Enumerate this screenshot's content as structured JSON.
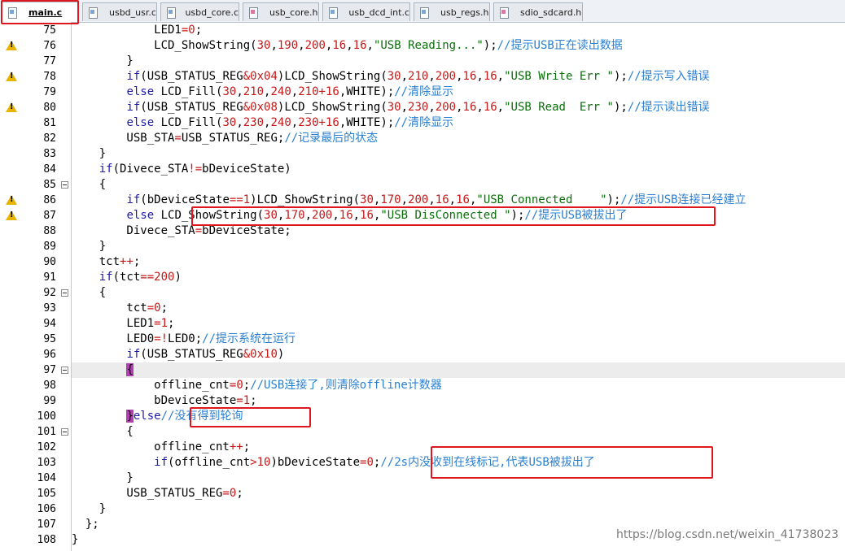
{
  "tabs": [
    {
      "label": "main.c",
      "type": "c",
      "active": true
    },
    {
      "label": "usbd_usr.c",
      "type": "c",
      "active": false
    },
    {
      "label": "usbd_core.c",
      "type": "c",
      "active": false
    },
    {
      "label": "usb_core.h",
      "type": "h",
      "active": false
    },
    {
      "label": "usb_dcd_int.c",
      "type": "c",
      "active": false
    },
    {
      "label": "usb_regs.h",
      "type": "c",
      "active": false
    },
    {
      "label": "sdio_sdcard.h",
      "type": "h",
      "active": false
    }
  ],
  "line_numbers": [
    "75",
    "76",
    "77",
    "78",
    "79",
    "80",
    "81",
    "82",
    "83",
    "84",
    "85",
    "86",
    "87",
    "88",
    "89",
    "90",
    "91",
    "92",
    "93",
    "94",
    "95",
    "96",
    "97",
    "98",
    "99",
    "100",
    "101",
    "102",
    "103",
    "104",
    "105",
    "106",
    "107",
    "108"
  ],
  "code": [
    [
      {
        "t": "            LED1",
        "c": ""
      },
      {
        "t": "=",
        "c": "op"
      },
      {
        "t": "0",
        "c": "num"
      },
      {
        "t": ";",
        "c": ""
      }
    ],
    [
      {
        "t": "            LCD_ShowString(",
        "c": ""
      },
      {
        "t": "30",
        "c": "num"
      },
      {
        "t": ",",
        "c": ""
      },
      {
        "t": "190",
        "c": "num"
      },
      {
        "t": ",",
        "c": ""
      },
      {
        "t": "200",
        "c": "num"
      },
      {
        "t": ",",
        "c": ""
      },
      {
        "t": "16",
        "c": "num"
      },
      {
        "t": ",",
        "c": ""
      },
      {
        "t": "16",
        "c": "num"
      },
      {
        "t": ",",
        "c": ""
      },
      {
        "t": "\"USB Reading...\"",
        "c": "str"
      },
      {
        "t": ");",
        "c": ""
      },
      {
        "t": "//提示USB正在读出数据",
        "c": "cm"
      }
    ],
    [
      {
        "t": "        }",
        "c": ""
      }
    ],
    [
      {
        "t": "        ",
        "c": ""
      },
      {
        "t": "if",
        "c": "kw"
      },
      {
        "t": "(USB_STATUS_REG",
        "c": ""
      },
      {
        "t": "&",
        "c": "op"
      },
      {
        "t": "0x04",
        "c": "num"
      },
      {
        "t": ")LCD_ShowString(",
        "c": ""
      },
      {
        "t": "30",
        "c": "num"
      },
      {
        "t": ",",
        "c": ""
      },
      {
        "t": "210",
        "c": "num"
      },
      {
        "t": ",",
        "c": ""
      },
      {
        "t": "200",
        "c": "num"
      },
      {
        "t": ",",
        "c": ""
      },
      {
        "t": "16",
        "c": "num"
      },
      {
        "t": ",",
        "c": ""
      },
      {
        "t": "16",
        "c": "num"
      },
      {
        "t": ",",
        "c": ""
      },
      {
        "t": "\"USB Write Err \"",
        "c": "str"
      },
      {
        "t": ");",
        "c": ""
      },
      {
        "t": "//提示写入错误",
        "c": "cm"
      }
    ],
    [
      {
        "t": "        ",
        "c": ""
      },
      {
        "t": "else",
        "c": "kw"
      },
      {
        "t": " LCD_Fill(",
        "c": ""
      },
      {
        "t": "30",
        "c": "num"
      },
      {
        "t": ",",
        "c": ""
      },
      {
        "t": "210",
        "c": "num"
      },
      {
        "t": ",",
        "c": ""
      },
      {
        "t": "240",
        "c": "num"
      },
      {
        "t": ",",
        "c": ""
      },
      {
        "t": "210",
        "c": "num"
      },
      {
        "t": "+",
        "c": "op"
      },
      {
        "t": "16",
        "c": "num"
      },
      {
        "t": ",WHITE);",
        "c": ""
      },
      {
        "t": "//清除显示",
        "c": "cm"
      }
    ],
    [
      {
        "t": "        ",
        "c": ""
      },
      {
        "t": "if",
        "c": "kw"
      },
      {
        "t": "(USB_STATUS_REG",
        "c": ""
      },
      {
        "t": "&",
        "c": "op"
      },
      {
        "t": "0x08",
        "c": "num"
      },
      {
        "t": ")LCD_ShowString(",
        "c": ""
      },
      {
        "t": "30",
        "c": "num"
      },
      {
        "t": ",",
        "c": ""
      },
      {
        "t": "230",
        "c": "num"
      },
      {
        "t": ",",
        "c": ""
      },
      {
        "t": "200",
        "c": "num"
      },
      {
        "t": ",",
        "c": ""
      },
      {
        "t": "16",
        "c": "num"
      },
      {
        "t": ",",
        "c": ""
      },
      {
        "t": "16",
        "c": "num"
      },
      {
        "t": ",",
        "c": ""
      },
      {
        "t": "\"USB Read  Err \"",
        "c": "str"
      },
      {
        "t": ");",
        "c": ""
      },
      {
        "t": "//提示读出错误",
        "c": "cm"
      }
    ],
    [
      {
        "t": "        ",
        "c": ""
      },
      {
        "t": "else",
        "c": "kw"
      },
      {
        "t": " LCD_Fill(",
        "c": ""
      },
      {
        "t": "30",
        "c": "num"
      },
      {
        "t": ",",
        "c": ""
      },
      {
        "t": "230",
        "c": "num"
      },
      {
        "t": ",",
        "c": ""
      },
      {
        "t": "240",
        "c": "num"
      },
      {
        "t": ",",
        "c": ""
      },
      {
        "t": "230",
        "c": "num"
      },
      {
        "t": "+",
        "c": "op"
      },
      {
        "t": "16",
        "c": "num"
      },
      {
        "t": ",WHITE);",
        "c": ""
      },
      {
        "t": "//清除显示",
        "c": "cm"
      }
    ],
    [
      {
        "t": "        USB_STA",
        "c": ""
      },
      {
        "t": "=",
        "c": "op"
      },
      {
        "t": "USB_STATUS_REG;",
        "c": ""
      },
      {
        "t": "//记录最后的状态",
        "c": "cm"
      }
    ],
    [
      {
        "t": "    }",
        "c": ""
      }
    ],
    [
      {
        "t": "    ",
        "c": ""
      },
      {
        "t": "if",
        "c": "kw"
      },
      {
        "t": "(Divece_STA",
        "c": ""
      },
      {
        "t": "!=",
        "c": "op"
      },
      {
        "t": "bDeviceState)",
        "c": ""
      }
    ],
    [
      {
        "t": "    {",
        "c": ""
      }
    ],
    [
      {
        "t": "        ",
        "c": ""
      },
      {
        "t": "if",
        "c": "kw"
      },
      {
        "t": "(bDeviceState",
        "c": ""
      },
      {
        "t": "==",
        "c": "op"
      },
      {
        "t": "1",
        "c": "num"
      },
      {
        "t": ")LCD_ShowString(",
        "c": ""
      },
      {
        "t": "30",
        "c": "num"
      },
      {
        "t": ",",
        "c": ""
      },
      {
        "t": "170",
        "c": "num"
      },
      {
        "t": ",",
        "c": ""
      },
      {
        "t": "200",
        "c": "num"
      },
      {
        "t": ",",
        "c": ""
      },
      {
        "t": "16",
        "c": "num"
      },
      {
        "t": ",",
        "c": ""
      },
      {
        "t": "16",
        "c": "num"
      },
      {
        "t": ",",
        "c": ""
      },
      {
        "t": "\"USB Connected    \"",
        "c": "str"
      },
      {
        "t": ");",
        "c": ""
      },
      {
        "t": "//提示USB连接已经建立",
        "c": "cm"
      }
    ],
    [
      {
        "t": "        ",
        "c": ""
      },
      {
        "t": "else",
        "c": "kw"
      },
      {
        "t": " LCD_ShowString(",
        "c": ""
      },
      {
        "t": "30",
        "c": "num"
      },
      {
        "t": ",",
        "c": ""
      },
      {
        "t": "170",
        "c": "num"
      },
      {
        "t": ",",
        "c": ""
      },
      {
        "t": "200",
        "c": "num"
      },
      {
        "t": ",",
        "c": ""
      },
      {
        "t": "16",
        "c": "num"
      },
      {
        "t": ",",
        "c": ""
      },
      {
        "t": "16",
        "c": "num"
      },
      {
        "t": ",",
        "c": ""
      },
      {
        "t": "\"USB DisConnected \"",
        "c": "str"
      },
      {
        "t": ");",
        "c": ""
      },
      {
        "t": "//提示USB被拔出了",
        "c": "cm"
      }
    ],
    [
      {
        "t": "        Divece_STA",
        "c": ""
      },
      {
        "t": "=",
        "c": "op"
      },
      {
        "t": "bDeviceState;",
        "c": ""
      }
    ],
    [
      {
        "t": "    }",
        "c": ""
      }
    ],
    [
      {
        "t": "    tct",
        "c": ""
      },
      {
        "t": "++",
        "c": "op"
      },
      {
        "t": ";",
        "c": ""
      }
    ],
    [
      {
        "t": "    ",
        "c": ""
      },
      {
        "t": "if",
        "c": "kw"
      },
      {
        "t": "(tct",
        "c": ""
      },
      {
        "t": "==",
        "c": "op"
      },
      {
        "t": "200",
        "c": "num"
      },
      {
        "t": ")",
        "c": ""
      }
    ],
    [
      {
        "t": "    {",
        "c": ""
      }
    ],
    [
      {
        "t": "        tct",
        "c": ""
      },
      {
        "t": "=",
        "c": "op"
      },
      {
        "t": "0",
        "c": "num"
      },
      {
        "t": ";",
        "c": ""
      }
    ],
    [
      {
        "t": "        LED1",
        "c": ""
      },
      {
        "t": "=",
        "c": "op"
      },
      {
        "t": "1",
        "c": "num"
      },
      {
        "t": ";",
        "c": ""
      }
    ],
    [
      {
        "t": "        LED0",
        "c": ""
      },
      {
        "t": "=!",
        "c": "op"
      },
      {
        "t": "LED0;",
        "c": ""
      },
      {
        "t": "//提示系统在运行",
        "c": "cm"
      }
    ],
    [
      {
        "t": "        ",
        "c": ""
      },
      {
        "t": "if",
        "c": "kw"
      },
      {
        "t": "(USB_STATUS_REG",
        "c": ""
      },
      {
        "t": "&",
        "c": "op"
      },
      {
        "t": "0x10",
        "c": "num"
      },
      {
        "t": ")",
        "c": ""
      }
    ],
    [
      {
        "t": "        ",
        "c": ""
      },
      {
        "t": "{",
        "c": "caret"
      }
    ],
    [
      {
        "t": "            offline_cnt",
        "c": ""
      },
      {
        "t": "=",
        "c": "op"
      },
      {
        "t": "0",
        "c": "num"
      },
      {
        "t": ";",
        "c": ""
      },
      {
        "t": "//USB连接了,则清除offline计数器",
        "c": "cm"
      }
    ],
    [
      {
        "t": "            bDeviceState",
        "c": ""
      },
      {
        "t": "=",
        "c": "op"
      },
      {
        "t": "1",
        "c": "num"
      },
      {
        "t": ";",
        "c": ""
      }
    ],
    [
      {
        "t": "        ",
        "c": ""
      },
      {
        "t": "}",
        "c": "caret"
      },
      {
        "t": "else",
        "c": "kw"
      },
      {
        "t": "//没有得到轮询",
        "c": "cm"
      }
    ],
    [
      {
        "t": "        {",
        "c": ""
      }
    ],
    [
      {
        "t": "            offline_cnt",
        "c": ""
      },
      {
        "t": "++",
        "c": "op"
      },
      {
        "t": ";",
        "c": ""
      }
    ],
    [
      {
        "t": "            ",
        "c": ""
      },
      {
        "t": "if",
        "c": "kw"
      },
      {
        "t": "(offline_cnt",
        "c": ""
      },
      {
        "t": ">",
        "c": "op"
      },
      {
        "t": "10",
        "c": "num"
      },
      {
        "t": ")bDeviceState",
        "c": ""
      },
      {
        "t": "=",
        "c": "op"
      },
      {
        "t": "0",
        "c": "num"
      },
      {
        "t": ";",
        "c": ""
      },
      {
        "t": "//2s内没收到在线标记,代表USB被拔出了",
        "c": "cm"
      }
    ],
    [
      {
        "t": "        }",
        "c": ""
      }
    ],
    [
      {
        "t": "        USB_STATUS_REG",
        "c": ""
      },
      {
        "t": "=",
        "c": "op"
      },
      {
        "t": "0",
        "c": "num"
      },
      {
        "t": ";",
        "c": ""
      }
    ],
    [
      {
        "t": "    }",
        "c": ""
      }
    ],
    [
      {
        "t": "  };",
        "c": ""
      }
    ],
    [
      {
        "t": "}",
        "c": ""
      }
    ]
  ],
  "warning_lines": [
    1,
    3,
    5,
    11,
    12
  ],
  "fold_lines": [
    10,
    17,
    22,
    26
  ],
  "highlight_line": 22,
  "watermark": "https://blog.csdn.net/weixin_41738023",
  "colors": {
    "keyword": "#1f1ca8",
    "number": "#c81717",
    "string": "#0a6e0a",
    "comment": "#2b7fd0",
    "annotation": "#e0161e"
  }
}
